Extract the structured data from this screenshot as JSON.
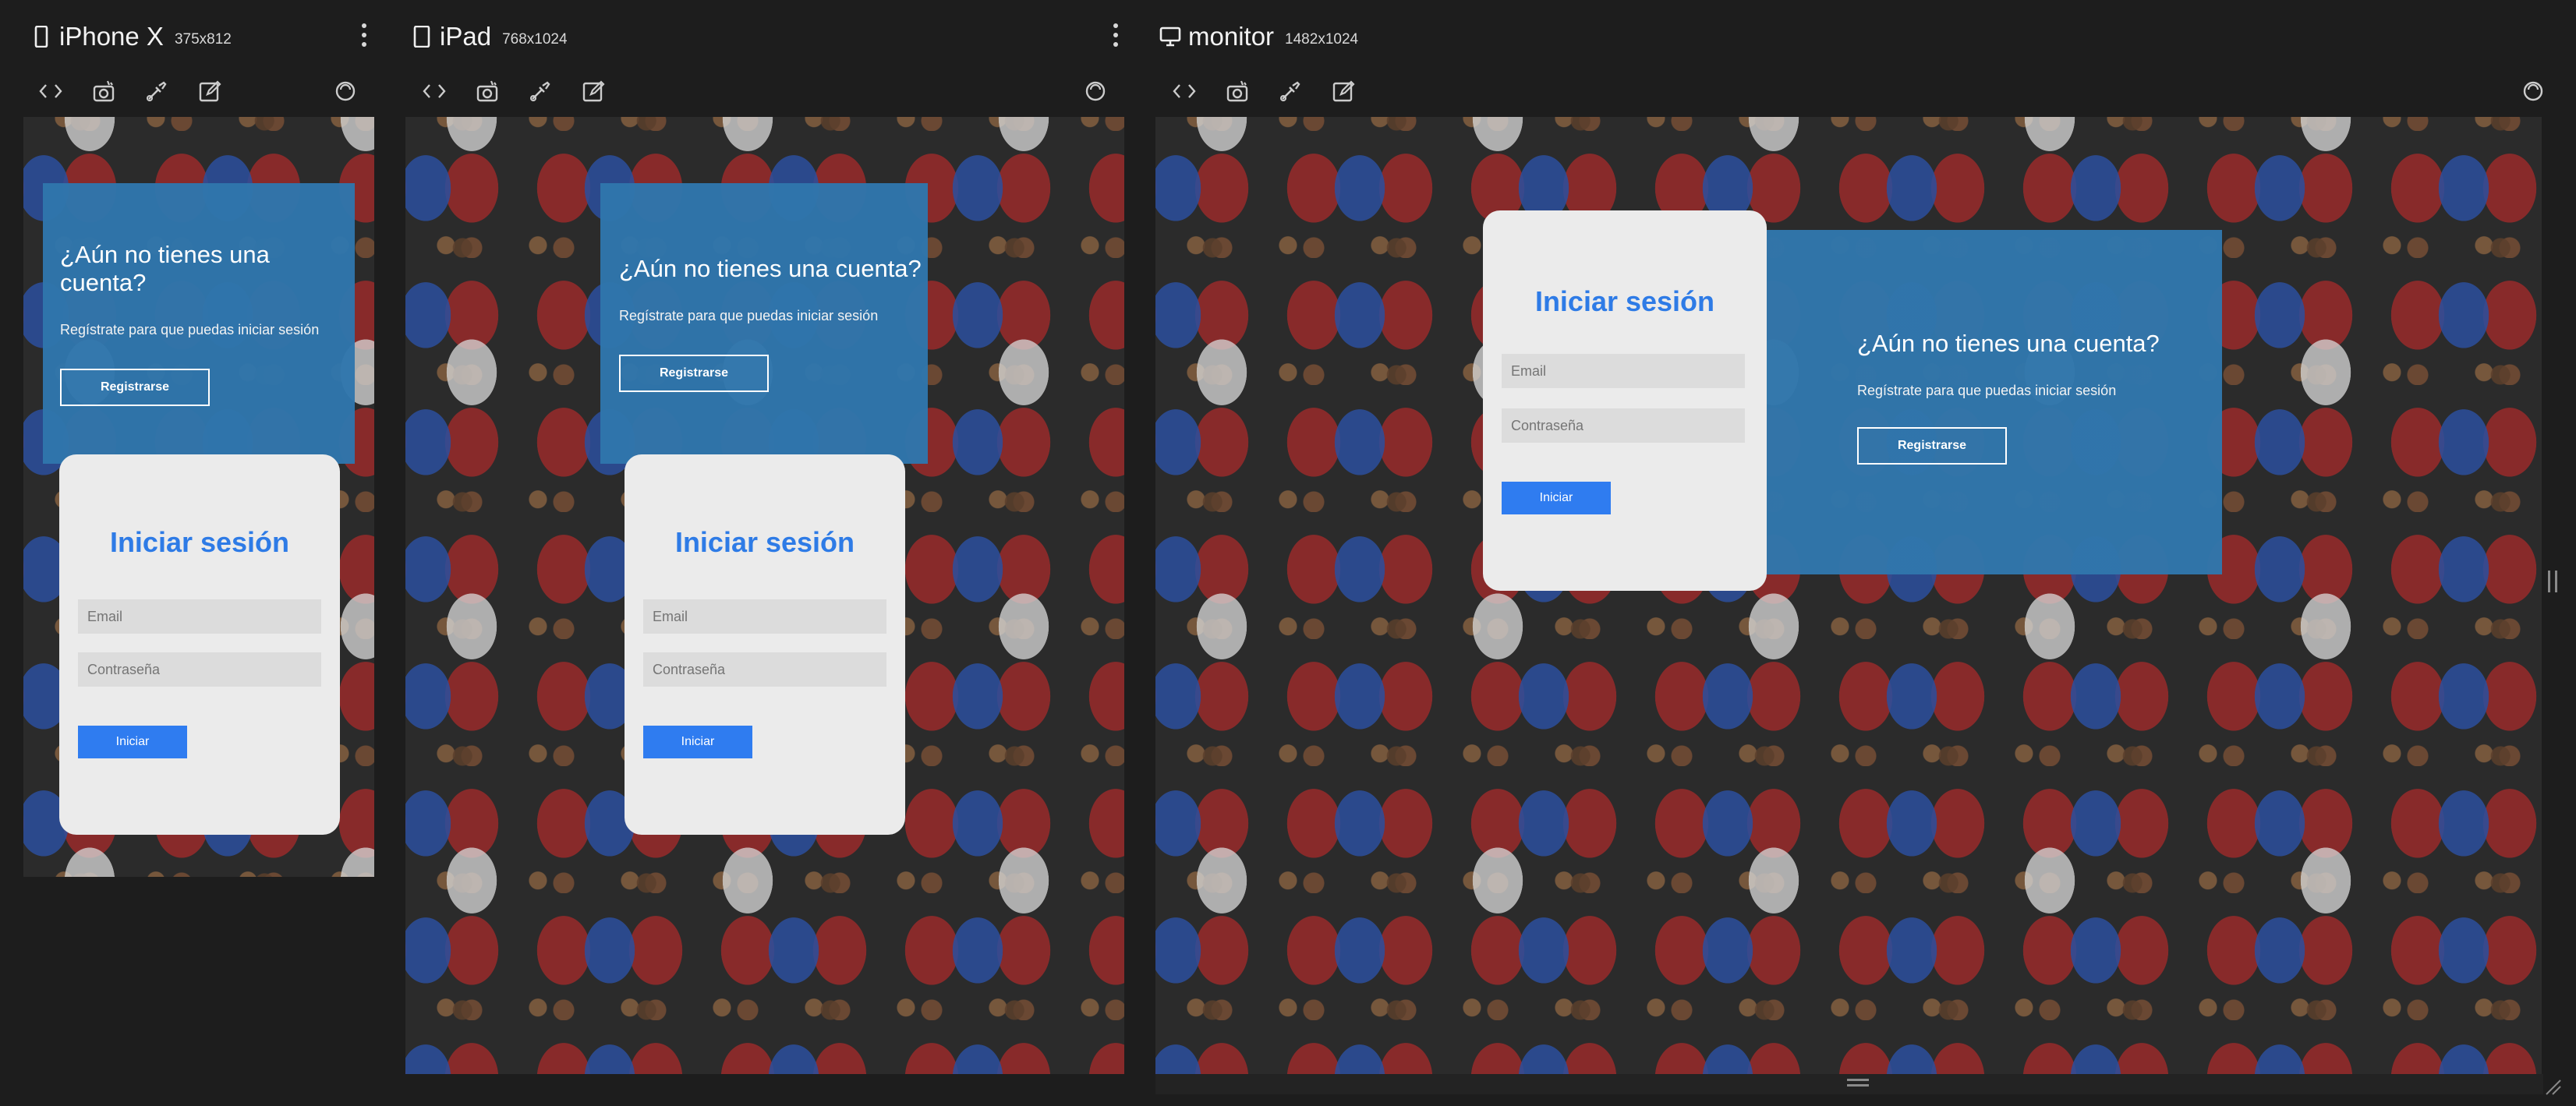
{
  "devices": [
    {
      "name": "iPhone X",
      "size": "375x812",
      "type_icon": "phone-icon",
      "content": {
        "signup_title": "¿Aún no tienes una cuenta?",
        "signup_text": "Regístrate para que puedas iniciar sesión",
        "signup_button": "Registrarse",
        "login_title": "Iniciar sesión",
        "email_placeholder": "Email",
        "password_placeholder": "Contraseña",
        "login_button": "Iniciar"
      }
    },
    {
      "name": "iPad",
      "size": "768x1024",
      "type_icon": "tablet-icon",
      "content": {
        "signup_title": "¿Aún no tienes una cuenta?",
        "signup_text": "Regístrate para que puedas iniciar sesión",
        "signup_button": "Registrarse",
        "login_title": "Iniciar sesión",
        "email_placeholder": "Email",
        "password_placeholder": "Contraseña",
        "login_button": "Iniciar"
      }
    },
    {
      "name": "monitor",
      "size": "1482x1024",
      "type_icon": "monitor-icon",
      "content": {
        "signup_title": "¿Aún no tienes una cuenta?",
        "signup_text": "Regístrate para que puedas iniciar sesión",
        "signup_button": "Registrarse",
        "login_title": "Iniciar sesión",
        "email_placeholder": "Email",
        "password_placeholder": "Contraseña",
        "login_button": "Iniciar"
      }
    }
  ],
  "toolbar_icons": [
    "code-icon",
    "screenshot-icon",
    "eyedropper-icon",
    "edit-icon",
    "rotate-icon"
  ],
  "colors": {
    "panel_bg": "#1d1d1d",
    "signup_blue": "#3076ac",
    "login_card": "#ebebeb",
    "accent_blue": "#2f7cf0",
    "title_blue": "#2e7be6"
  }
}
